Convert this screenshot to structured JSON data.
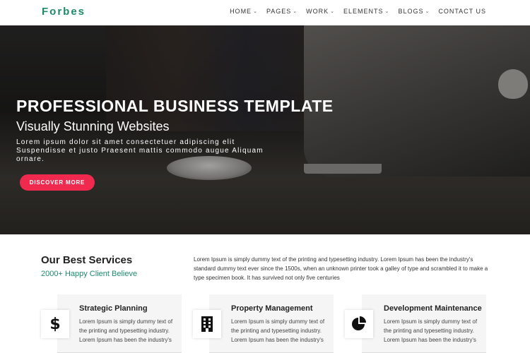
{
  "header": {
    "logo": "Forbes",
    "nav": [
      {
        "label": "HOME",
        "dropdown": true
      },
      {
        "label": "PAGES",
        "dropdown": true
      },
      {
        "label": "WORK",
        "dropdown": true
      },
      {
        "label": "ELEMENTS",
        "dropdown": true
      },
      {
        "label": "BLOGS",
        "dropdown": true
      },
      {
        "label": "CONTACT US",
        "dropdown": false
      }
    ]
  },
  "hero": {
    "title": "PROFESSIONAL BUSINESS TEMPLATE",
    "subtitle": "Visually Stunning Websites",
    "text": "Lorem ipsum dolor sit amet consectetuer adipiscing elit Suspendisse et justo Praesent mattis commodo augue Aliquam ornare.",
    "button": "DISCOVER MORE"
  },
  "services": {
    "title": "Our Best Services",
    "subtitle": "2000+ Happy Client Believe",
    "description": "Lorem Ipsum is simply dummy text of the printing and typesetting industry. Lorem Ipsum has been the industry's standard dummy text ever since the 1500s, when an unknown printer took a galley of type and scrambled it to make a type specimen book. It has survived not only five centuries",
    "cards": [
      {
        "icon": "dollar-icon",
        "title": "Strategic Planning",
        "text": "Lorem Ipsum is simply dummy text of the printing and typesetting industry. Lorem Ipsum has been the industry's"
      },
      {
        "icon": "building-icon",
        "title": "Property Management",
        "text": "Lorem Ipsum is simply dummy text of the printing and typesetting industry. Lorem Ipsum has been the industry's"
      },
      {
        "icon": "pie-chart-icon",
        "title": "Development Maintenance",
        "text": "Lorem Ipsum is simply dummy text of the printing and typesetting industry. Lorem Ipsum has been the industry's"
      }
    ]
  },
  "colors": {
    "accent_green": "#1e8a6a",
    "button_pink": "#f0294f"
  }
}
